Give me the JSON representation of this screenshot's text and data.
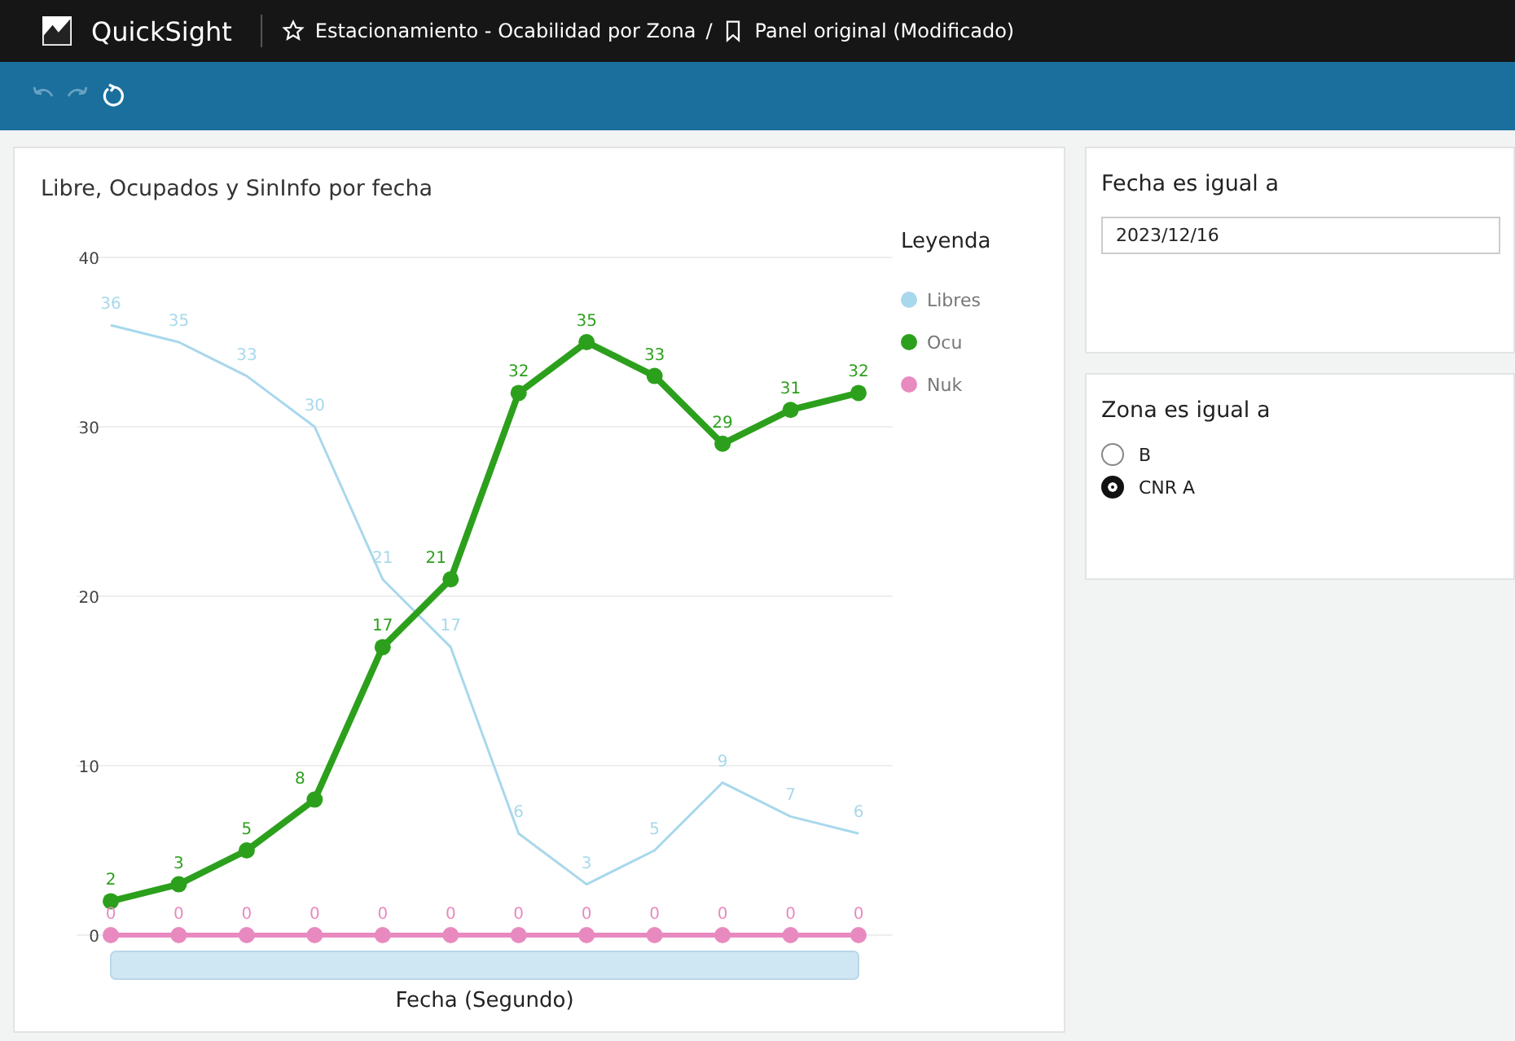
{
  "topbar": {
    "app_name": "QuickSight",
    "analysis_title": "Estacionamiento - Ocabilidad por Zona",
    "separator": "/",
    "sheet_title": "Panel original (Modificado)"
  },
  "toolbar": {
    "undo_disabled": true,
    "redo_disabled": true
  },
  "visual": {
    "title": "Libre, Ocupados y SinInfo por fecha",
    "chart_data": {
      "type": "line",
      "xlabel": "Fecha (Segundo)",
      "categories": [
        null,
        null,
        null,
        null,
        null,
        null,
        null,
        null,
        null,
        null,
        null,
        null
      ],
      "ylim": [
        0,
        40
      ],
      "yticks": [
        0,
        10,
        20,
        30,
        40
      ],
      "grid": true,
      "data_labels": true,
      "legend": {
        "title": "Leyenda"
      },
      "series": [
        {
          "name": "Libres",
          "color": "#a8d8ec",
          "marker": "none",
          "values": [
            36,
            35,
            33,
            30,
            21,
            17,
            6,
            3,
            5,
            9,
            7,
            6
          ]
        },
        {
          "name": "Ocu",
          "color": "#2ca01c",
          "marker": "circle",
          "values": [
            2,
            3,
            5,
            8,
            17,
            21,
            32,
            35,
            33,
            29,
            31,
            32
          ]
        },
        {
          "name": "Nuk",
          "color": "#e88ac0",
          "marker": "circle",
          "values": [
            0,
            0,
            0,
            0,
            0,
            0,
            0,
            0,
            0,
            0,
            0,
            0
          ]
        }
      ]
    }
  },
  "filters": [
    {
      "kind": "date",
      "title": "Fecha es igual a",
      "value": "2023/12/16"
    },
    {
      "kind": "radio",
      "title": "Zona es igual a",
      "options": [
        {
          "label": "B",
          "selected": false
        },
        {
          "label": "CNR A",
          "selected": true
        }
      ]
    }
  ]
}
